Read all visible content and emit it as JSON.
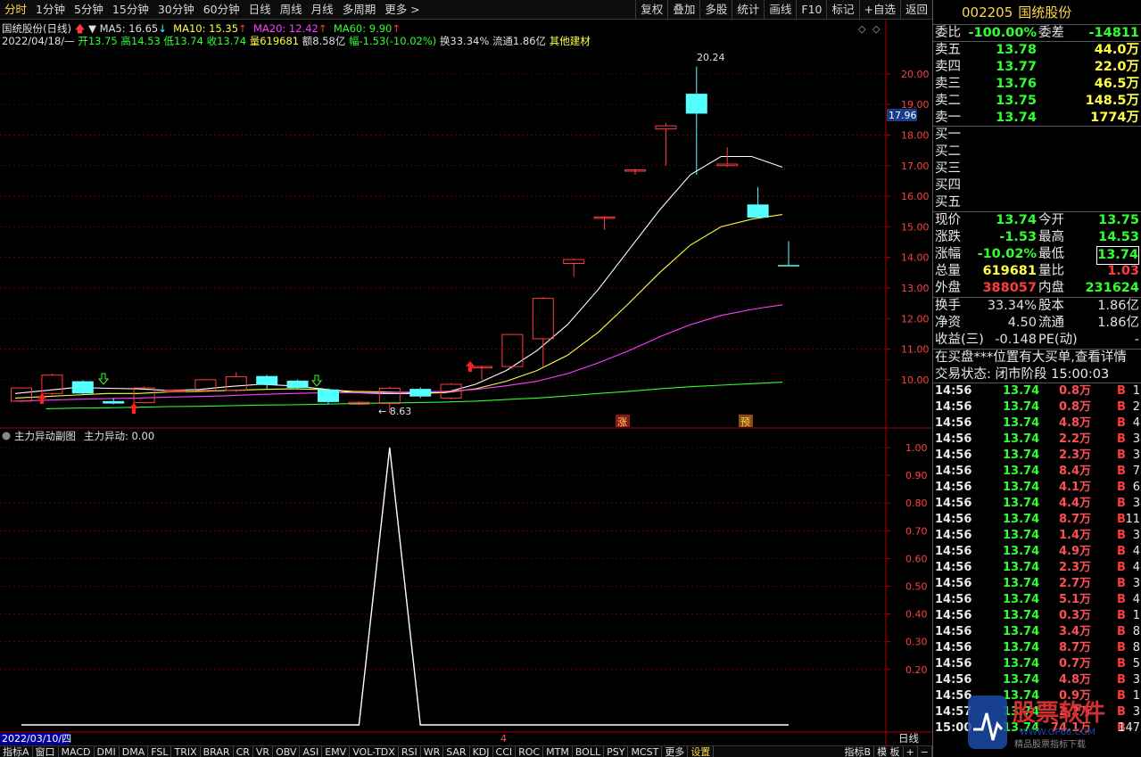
{
  "toolbar": {
    "periods": [
      "分时",
      "1分钟",
      "5分钟",
      "15分钟",
      "30分钟",
      "60分钟",
      "日线",
      "周线",
      "月线",
      "多周期",
      "更多 >"
    ],
    "active_period": 0,
    "actions": [
      "复权",
      "叠加",
      "多股",
      "统计",
      "画线",
      "F10",
      "标记",
      "+自选",
      "返回"
    ]
  },
  "info": {
    "stock_label": "国统股份(日线)",
    "ma5": "MA5: 16.65",
    "ma10": "MA10: 15.35",
    "ma20": "MA20: 12.42",
    "ma60": "MA60: 9.90",
    "date": "2022/04/18/—",
    "open": "开13.75",
    "high": "高14.53",
    "low": "低13.74",
    "close": "收13.74",
    "volume": "量619681",
    "amount": "额8.58亿",
    "change": "幅-1.53(-10.02%)",
    "turnover": "换33.34%",
    "float": "流通1.86亿",
    "sector": "其他建材"
  },
  "price_axis": {
    "labels": [
      "20.00",
      "19.00",
      "18.00",
      "17.00",
      "16.00",
      "15.00",
      "14.00",
      "13.00",
      "12.00",
      "11.00",
      "10.00"
    ],
    "current": "17.96"
  },
  "annotations": {
    "high_label": "20.24",
    "low_label": "8.63",
    "tag_zhang": "涨",
    "tag_yu": "预"
  },
  "candles": [
    {
      "o": 9.3,
      "c": 9.73,
      "h": 9.75,
      "l": 9.25
    },
    {
      "o": 9.55,
      "c": 10.15,
      "h": 10.2,
      "l": 9.5
    },
    {
      "o": 9.95,
      "c": 9.55,
      "h": 9.98,
      "l": 9.5
    },
    {
      "o": 9.3,
      "c": 9.22,
      "h": 9.4,
      "l": 9.2
    },
    {
      "o": 9.25,
      "c": 9.73,
      "h": 9.78,
      "l": 9.22
    },
    {
      "o": 9.62,
      "c": 9.65,
      "h": 9.69,
      "l": 9.6
    },
    {
      "o": 9.65,
      "c": 10.0,
      "h": 10.02,
      "l": 9.6
    },
    {
      "o": 9.65,
      "c": 10.1,
      "h": 10.25,
      "l": 9.6
    },
    {
      "o": 10.12,
      "c": 9.83,
      "h": 10.16,
      "l": 9.7
    },
    {
      "o": 9.97,
      "c": 9.73,
      "h": 10.01,
      "l": 9.7
    },
    {
      "o": 9.68,
      "c": 9.27,
      "h": 9.72,
      "l": 9.2
    },
    {
      "o": 9.2,
      "c": 9.26,
      "h": 9.3,
      "l": 9.18
    },
    {
      "o": 9.22,
      "c": 9.72,
      "h": 9.78,
      "l": 8.92
    },
    {
      "o": 9.7,
      "c": 9.45,
      "h": 9.75,
      "l": 9.4
    },
    {
      "o": 9.4,
      "c": 9.85,
      "h": 9.9,
      "l": 9.35
    },
    {
      "o": 10.43,
      "c": 10.43,
      "h": 10.46,
      "l": 10.0
    },
    {
      "o": 10.43,
      "c": 11.48,
      "h": 11.5,
      "l": 10.36
    },
    {
      "o": 11.34,
      "c": 12.66,
      "h": 12.7,
      "l": 10.4
    },
    {
      "o": 13.8,
      "c": 13.93,
      "h": 13.97,
      "l": 13.37
    },
    {
      "o": 15.3,
      "c": 15.32,
      "h": 15.35,
      "l": 14.9
    },
    {
      "o": 16.86,
      "c": 16.86,
      "h": 16.9,
      "l": 16.7
    },
    {
      "o": 18.2,
      "c": 18.3,
      "h": 18.4,
      "l": 17.0
    },
    {
      "o": 19.35,
      "c": 18.7,
      "h": 20.24,
      "l": 16.7
    },
    {
      "o": 17.0,
      "c": 17.05,
      "h": 17.6,
      "l": 16.95
    },
    {
      "o": 15.73,
      "c": 15.3,
      "h": 16.3,
      "l": 15.3
    },
    {
      "o": 13.75,
      "c": 13.74,
      "h": 14.53,
      "l": 13.74
    }
  ],
  "ma_lines": {
    "ma5": [
      9.55,
      9.65,
      9.75,
      9.72,
      9.7,
      9.65,
      9.68,
      9.78,
      9.85,
      9.8,
      9.7,
      9.58,
      9.55,
      9.55,
      9.58,
      9.85,
      10.3,
      10.95,
      11.8,
      12.95,
      14.25,
      15.55,
      16.7,
      17.3,
      17.3,
      16.95
    ],
    "ma10": [
      9.4,
      9.45,
      9.5,
      9.55,
      9.55,
      9.6,
      9.62,
      9.65,
      9.68,
      9.7,
      9.68,
      9.62,
      9.6,
      9.58,
      9.58,
      9.7,
      9.95,
      10.3,
      10.8,
      11.55,
      12.5,
      13.5,
      14.4,
      15.0,
      15.25,
      15.4
    ],
    "ma20": [
      9.3,
      9.33,
      9.36,
      9.38,
      9.4,
      9.43,
      9.45,
      9.48,
      9.52,
      9.55,
      9.57,
      9.58,
      9.58,
      9.6,
      9.62,
      9.68,
      9.8,
      9.95,
      10.2,
      10.55,
      10.95,
      11.4,
      11.8,
      12.1,
      12.3,
      12.45
    ],
    "ma60": [
      null,
      9.05,
      9.07,
      9.08,
      9.1,
      9.12,
      9.13,
      9.15,
      9.17,
      9.18,
      9.2,
      9.22,
      9.24,
      9.25,
      9.27,
      9.3,
      9.35,
      9.4,
      9.47,
      9.55,
      9.62,
      9.7,
      9.77,
      9.82,
      9.87,
      9.92
    ]
  },
  "sub_chart": {
    "title": "主力异动副图",
    "value_label": "主力异动: 0.00",
    "axis_labels": [
      "1.00",
      "0.90",
      "0.80",
      "0.70",
      "0.60",
      "0.50",
      "0.40",
      "0.30",
      "0.20"
    ],
    "values": [
      0,
      0,
      0,
      0,
      0,
      0,
      0,
      0,
      0,
      0,
      0,
      0,
      1,
      0,
      0,
      0,
      0,
      0,
      0,
      0,
      0,
      0,
      0,
      0,
      0,
      0
    ]
  },
  "date_bar": {
    "date": "2022/03/10/四",
    "month_mark": "4",
    "period_label": "日线"
  },
  "panel": {
    "code": "002205",
    "name": "国统股份",
    "weibi_label": "委比",
    "weibi": "-100.00%",
    "weicha_label": "委差",
    "weicha": "-14811",
    "asks": [
      {
        "label": "卖五",
        "price": "13.78",
        "vol": "44.0万"
      },
      {
        "label": "卖四",
        "price": "13.77",
        "vol": "22.0万"
      },
      {
        "label": "卖三",
        "price": "13.76",
        "vol": "46.5万"
      },
      {
        "label": "卖二",
        "price": "13.75",
        "vol": "148.5万"
      },
      {
        "label": "卖一",
        "price": "13.74",
        "vol": "1774万"
      }
    ],
    "bids": [
      "买一",
      "买二",
      "买三",
      "买四",
      "买五"
    ],
    "quote": [
      {
        "l1": "现价",
        "v1": "13.74",
        "l2": "今开",
        "v2": "13.75"
      },
      {
        "l1": "涨跌",
        "v1": "-1.53",
        "l2": "最高",
        "v2": "14.53"
      },
      {
        "l1": "涨幅",
        "v1": "-10.02%",
        "l2": "最低",
        "v2": "13.74"
      },
      {
        "l1": "总量",
        "v1": "619681",
        "l2": "量比",
        "v2": "1.03"
      },
      {
        "l1": "外盘",
        "v1": "388057",
        "l2": "内盘",
        "v2": "231624"
      }
    ],
    "finance": [
      {
        "l1": "换手",
        "v1": "33.34%",
        "l2": "股本",
        "v2": "1.86亿"
      },
      {
        "l1": "净资",
        "v1": "4.50",
        "l2": "流通",
        "v2": "1.86亿"
      },
      {
        "l1": "收益(三)",
        "v1": "-0.148",
        "l2": "PE(动)",
        "v2": "-"
      }
    ],
    "message": "在买盘***位置有大买单,查看详情",
    "status": "交易状态: 闭市阶段 15:00:03",
    "ticks": [
      {
        "t": "14:56",
        "p": "13.74",
        "v": "0.8万",
        "bs": "B",
        "n": "1"
      },
      {
        "t": "14:56",
        "p": "13.74",
        "v": "0.8万",
        "bs": "B",
        "n": "2"
      },
      {
        "t": "14:56",
        "p": "13.74",
        "v": "4.8万",
        "bs": "B",
        "n": "4"
      },
      {
        "t": "14:56",
        "p": "13.74",
        "v": "2.2万",
        "bs": "B",
        "n": "3"
      },
      {
        "t": "14:56",
        "p": "13.74",
        "v": "2.3万",
        "bs": "B",
        "n": "3"
      },
      {
        "t": "14:56",
        "p": "13.74",
        "v": "8.4万",
        "bs": "B",
        "n": "7"
      },
      {
        "t": "14:56",
        "p": "13.74",
        "v": "4.1万",
        "bs": "B",
        "n": "6"
      },
      {
        "t": "14:56",
        "p": "13.74",
        "v": "4.4万",
        "bs": "B",
        "n": "3"
      },
      {
        "t": "14:56",
        "p": "13.74",
        "v": "8.7万",
        "bs": "B",
        "n": "11"
      },
      {
        "t": "14:56",
        "p": "13.74",
        "v": "1.4万",
        "bs": "B",
        "n": "3"
      },
      {
        "t": "14:56",
        "p": "13.74",
        "v": "4.9万",
        "bs": "B",
        "n": "4"
      },
      {
        "t": "14:56",
        "p": "13.74",
        "v": "2.3万",
        "bs": "B",
        "n": "4"
      },
      {
        "t": "14:56",
        "p": "13.74",
        "v": "2.7万",
        "bs": "B",
        "n": "3"
      },
      {
        "t": "14:56",
        "p": "13.74",
        "v": "5.1万",
        "bs": "B",
        "n": "4"
      },
      {
        "t": "14:56",
        "p": "13.74",
        "v": "0.3万",
        "bs": "B",
        "n": "1"
      },
      {
        "t": "14:56",
        "p": "13.74",
        "v": "3.4万",
        "bs": "B",
        "n": "8"
      },
      {
        "t": "14:56",
        "p": "13.74",
        "v": "8.7万",
        "bs": "B",
        "n": "8"
      },
      {
        "t": "14:56",
        "p": "13.74",
        "v": "0.7万",
        "bs": "B",
        "n": "5"
      },
      {
        "t": "14:56",
        "p": "13.74",
        "v": "4.8万",
        "bs": "B",
        "n": "3"
      },
      {
        "t": "14:56",
        "p": "13.74",
        "v": "0.9万",
        "bs": "B",
        "n": "1"
      },
      {
        "t": "14:57",
        "p": "13.74",
        "v": "2.2万",
        "bs": "B",
        "n": "3"
      },
      {
        "t": "15:00",
        "p": "13.74",
        "v": "74.1万",
        "bs": "B",
        "n": "147"
      }
    ]
  },
  "tabs": [
    "指标A",
    "窗口",
    "MACD",
    "DMI",
    "DMA",
    "FSL",
    "TRIX",
    "BRAR",
    "CR",
    "VR",
    "OBV",
    "ASI",
    "EMV",
    "VOL-TDX",
    "RSI",
    "WR",
    "SAR",
    "KDJ",
    "CCI",
    "ROC",
    "MTM",
    "BOLL",
    "PSY",
    "MCST",
    "更多",
    "设置"
  ],
  "tabs_right": [
    "指标B",
    "模 板",
    "+",
    "−"
  ],
  "watermark": {
    "brand": "股票软件",
    "site": "WWW.GP66.COM",
    "tagline": "精品股票指标下载"
  },
  "colors": {
    "up": "#ff3c3c",
    "down": "#54ffff",
    "ma5": "#ffffff",
    "ma10": "#ffff40",
    "ma20": "#ff40ff",
    "ma60": "#30ff30",
    "grid": "#7a0000",
    "axis": "#b00000"
  }
}
